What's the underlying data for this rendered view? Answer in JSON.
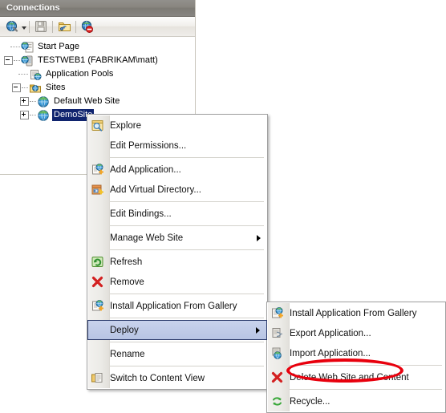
{
  "panel": {
    "title": "Connections",
    "toolbar": [
      {
        "name": "connect-to-server-button",
        "icon": "globe-with-dropdown-icon",
        "label": "Connect to..."
      },
      {
        "name": "save-connections-button",
        "icon": "save-disk-icon",
        "label": "Save Connections"
      },
      {
        "name": "new-connection-button",
        "icon": "folder-connection-icon",
        "label": "New Connection"
      },
      {
        "name": "disconnect-button",
        "icon": "globe-disconnect-icon",
        "label": "Disconnect"
      }
    ]
  },
  "tree": {
    "nodes": [
      {
        "label": "Start Page",
        "icon": "start-page-icon",
        "depth": 0,
        "expander": "none",
        "selected": false
      },
      {
        "label": "TESTWEB1 (FABRIKAM\\matt)",
        "icon": "server-icon",
        "depth": 0,
        "expander": "minus",
        "selected": false
      },
      {
        "label": "Application Pools",
        "icon": "application-pools-icon",
        "depth": 1,
        "expander": "none",
        "selected": false
      },
      {
        "label": "Sites",
        "icon": "sites-folder-icon",
        "depth": 1,
        "expander": "minus",
        "selected": false
      },
      {
        "label": "Default Web Site",
        "icon": "website-icon",
        "depth": 2,
        "expander": "plus",
        "selected": false
      },
      {
        "label": "DemoSite",
        "icon": "website-icon",
        "depth": 2,
        "expander": "plus",
        "selected": true
      }
    ]
  },
  "context_menu": {
    "name": "site-context-menu",
    "items": [
      {
        "type": "item",
        "label": "Explore",
        "icon": "explore-magnifier-icon",
        "submenu": false,
        "highlighted": false
      },
      {
        "type": "item",
        "label": "Edit Permissions...",
        "icon": "none",
        "submenu": false,
        "highlighted": false
      },
      {
        "type": "separator"
      },
      {
        "type": "item",
        "label": "Add Application...",
        "icon": "add-application-icon",
        "submenu": false,
        "highlighted": false
      },
      {
        "type": "item",
        "label": "Add Virtual Directory...",
        "icon": "add-virtual-directory-icon",
        "submenu": false,
        "highlighted": false
      },
      {
        "type": "separator"
      },
      {
        "type": "item",
        "label": "Edit Bindings...",
        "icon": "none",
        "submenu": false,
        "highlighted": false
      },
      {
        "type": "separator"
      },
      {
        "type": "item",
        "label": "Manage Web Site",
        "icon": "none",
        "submenu": true,
        "highlighted": false
      },
      {
        "type": "separator"
      },
      {
        "type": "item",
        "label": "Refresh",
        "icon": "refresh-green-icon",
        "submenu": false,
        "highlighted": false
      },
      {
        "type": "item",
        "label": "Remove",
        "icon": "remove-red-x-icon",
        "submenu": false,
        "highlighted": false
      },
      {
        "type": "separator"
      },
      {
        "type": "item",
        "label": "Install Application From Gallery",
        "icon": "gallery-install-icon",
        "submenu": false,
        "highlighted": false
      },
      {
        "type": "separator"
      },
      {
        "type": "item",
        "label": "Deploy",
        "icon": "none",
        "submenu": true,
        "highlighted": true
      },
      {
        "type": "separator"
      },
      {
        "type": "item",
        "label": "Rename",
        "icon": "none",
        "submenu": false,
        "highlighted": false
      },
      {
        "type": "separator"
      },
      {
        "type": "item",
        "label": "Switch to Content View",
        "icon": "content-view-icon",
        "submenu": false,
        "highlighted": false
      }
    ]
  },
  "deploy_submenu": {
    "name": "deploy-submenu",
    "items": [
      {
        "type": "item",
        "label": "Install Application From Gallery",
        "icon": "gallery-install-icon",
        "annotated": false
      },
      {
        "type": "item",
        "label": "Export Application...",
        "icon": "export-application-icon",
        "annotated": false
      },
      {
        "type": "item",
        "label": "Import Application...",
        "icon": "import-application-icon",
        "annotated": true
      },
      {
        "type": "separator"
      },
      {
        "type": "item",
        "label": "Delete Web Site and Content",
        "icon": "remove-red-x-icon",
        "annotated": false
      },
      {
        "type": "separator"
      },
      {
        "type": "item",
        "label": "Recycle...",
        "icon": "recycle-green-icon",
        "annotated": false
      }
    ]
  },
  "annotation": {
    "name": "import-application-highlight-ellipse",
    "color": "#e8000d",
    "target": "Import Application..."
  }
}
